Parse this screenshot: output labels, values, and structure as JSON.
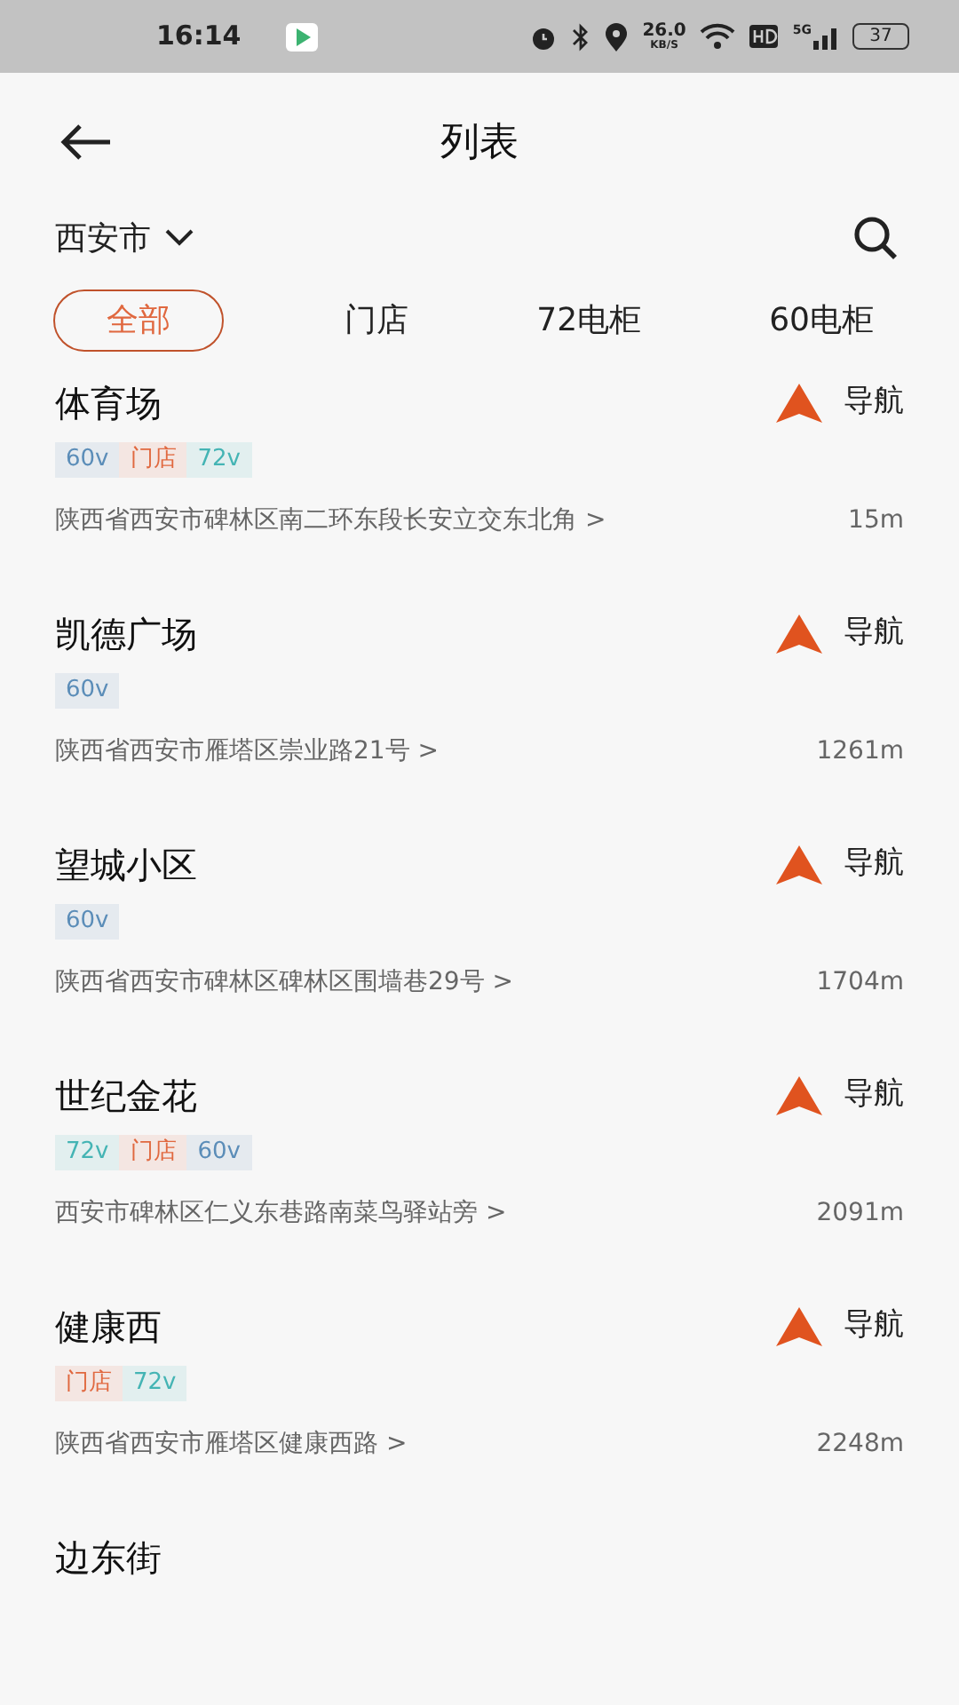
{
  "status_bar": {
    "time": "16:14",
    "speed": "26.0",
    "speed_unit": "KB/S",
    "network": "5G",
    "battery": "37"
  },
  "header": {
    "title": "列表"
  },
  "city": {
    "label": "西安市"
  },
  "tabs": [
    {
      "label": "全部",
      "selected": true
    },
    {
      "label": "门店",
      "selected": false
    },
    {
      "label": "72电柜",
      "selected": false
    },
    {
      "label": "60电柜",
      "selected": false
    }
  ],
  "stations": [
    {
      "name": "体育场",
      "nav": "导航",
      "tags": [
        {
          "text": "60v",
          "color": "#5b8db8"
        },
        {
          "text": "门店",
          "color": "#e0683f"
        },
        {
          "text": "72v",
          "color": "#44b4b4"
        }
      ],
      "address": "陕西省西安市碑林区南二环东段长安立交东北角 >",
      "distance": "15m"
    },
    {
      "name": "凯德广场",
      "nav": "导航",
      "tags": [
        {
          "text": "60v",
          "color": "#5b8db8"
        }
      ],
      "address": "陕西省西安市雁塔区崇业路21号 >",
      "distance": "1261m"
    },
    {
      "name": "望城小区",
      "nav": "导航",
      "tags": [
        {
          "text": "60v",
          "color": "#5b8db8"
        }
      ],
      "address": "陕西省西安市碑林区碑林区围墙巷29号 >",
      "distance": "1704m"
    },
    {
      "name": "世纪金花",
      "nav": "导航",
      "tags": [
        {
          "text": "72v",
          "color": "#44b4b4"
        },
        {
          "text": "门店",
          "color": "#e0683f"
        },
        {
          "text": "60v",
          "color": "#5b8db8"
        }
      ],
      "address": "西安市碑林区仁义东巷路南菜鸟驿站旁 >",
      "distance": "2091m"
    },
    {
      "name": "健康西",
      "nav": "导航",
      "tags": [
        {
          "text": "门店",
          "color": "#e0683f"
        },
        {
          "text": "72v",
          "color": "#44b4b4"
        }
      ],
      "address": "陕西省西安市雁塔区健康西路 >",
      "distance": "2248m"
    },
    {
      "name": "边东街"
    }
  ]
}
